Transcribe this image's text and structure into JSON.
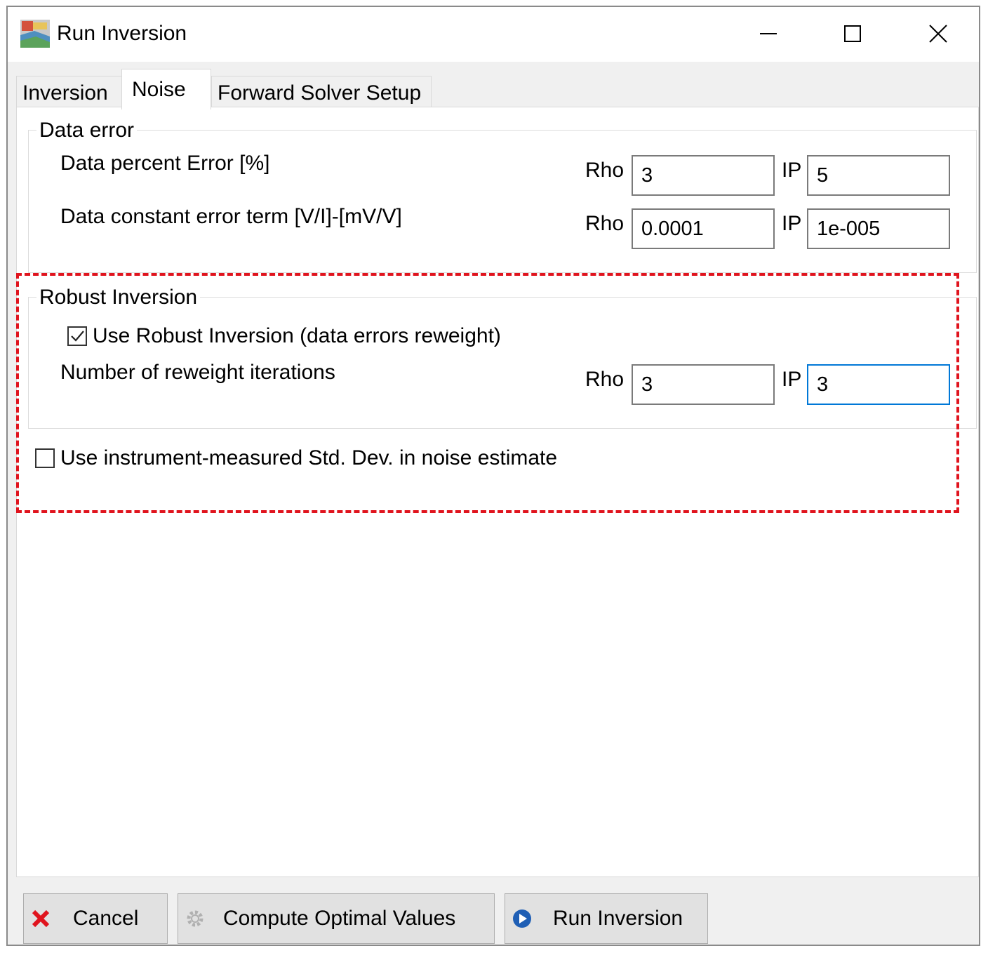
{
  "window": {
    "title": "Run Inversion",
    "app_icon": "app-logo-icon",
    "controls": [
      "minimize-icon",
      "maximize-icon",
      "close-icon"
    ]
  },
  "tabs": [
    {
      "label": "Inversion",
      "active": false
    },
    {
      "label": "Noise",
      "active": true
    },
    {
      "label": "Forward Solver Setup",
      "active": false
    }
  ],
  "data_error": {
    "legend": "Data error",
    "percent_label": "Data percent Error [%]",
    "percent_rho_label": "Rho",
    "percent_rho_value": "3",
    "percent_ip_label": "IP",
    "percent_ip_value": "5",
    "constant_label": "Data constant error term [V/I]-[mV/V]",
    "constant_rho_label": "Rho",
    "constant_rho_value": "0.0001",
    "constant_ip_label": "IP",
    "constant_ip_value": "1e-005"
  },
  "robust": {
    "legend": "Robust Inversion",
    "use_robust_label": "Use Robust Inversion (data errors reweight)",
    "use_robust_checked": true,
    "iterations_label": "Number of reweight iterations",
    "iter_rho_label": "Rho",
    "iter_rho_value": "3",
    "iter_ip_label": "IP",
    "iter_ip_value": "3"
  },
  "instrument": {
    "label": "Use instrument-measured Std. Dev. in noise estimate",
    "checked": false
  },
  "highlight_color": "#e0141e",
  "buttons": {
    "cancel": "Cancel",
    "compute": "Compute Optimal Values",
    "run": "Run Inversion"
  }
}
